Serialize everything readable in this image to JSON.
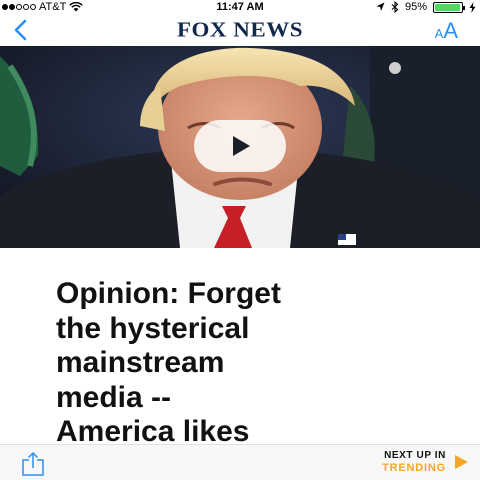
{
  "status_bar": {
    "signal_strength": 2,
    "signal_max": 5,
    "carrier": "AT&T",
    "time": "11:47 AM",
    "battery": "95%",
    "battery_level": 0.95,
    "icons": [
      "wifi-icon",
      "location-icon",
      "bluetooth-icon",
      "battery-icon",
      "charging-icon"
    ]
  },
  "nav": {
    "back_icon": "chevron-left-icon",
    "logo": "FOX NEWS",
    "text_size_small": "A",
    "text_size_large": "A"
  },
  "hero": {
    "play_icon": "play-icon"
  },
  "article": {
    "headline": "Opinion: Forget\nthe hysterical\nmainstream\nmedia --\nAmerica likes\nTrump's agenda,"
  },
  "bottom_bar": {
    "share_icon": "share-icon",
    "next_label": "NEXT UP IN",
    "next_topic": "TRENDING",
    "next_icon": "triangle-right-icon"
  },
  "colors": {
    "accent_blue": "#2e8ef0",
    "logo_navy": "#0f2a4e",
    "trending_orange": "#f5a623"
  }
}
